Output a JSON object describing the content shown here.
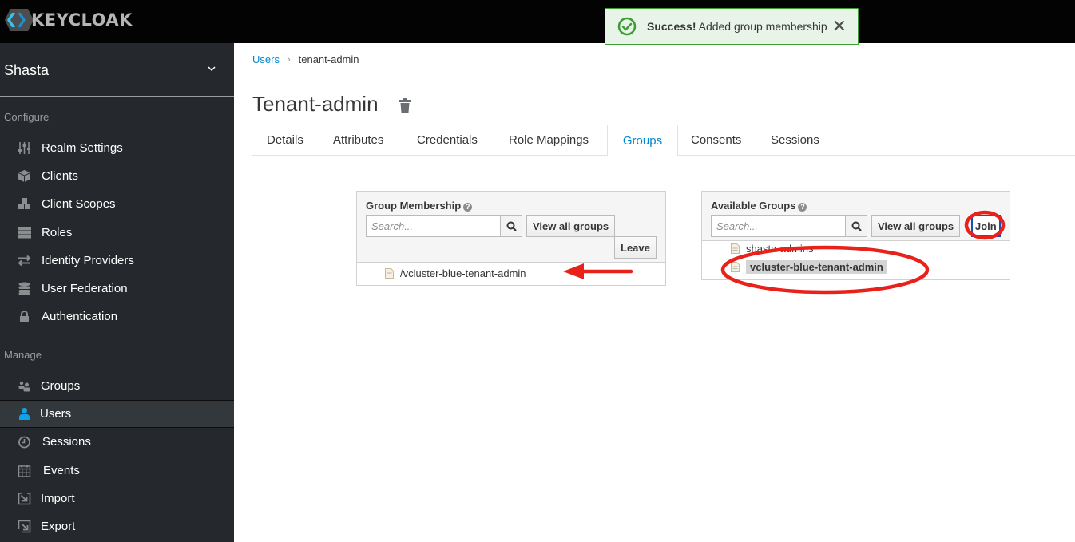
{
  "app": {
    "brand": "KEYCLOAK"
  },
  "toast": {
    "type": "success",
    "title": "Success!",
    "message": "Added group membership",
    "close_icon": "close-icon"
  },
  "sidebar": {
    "realm": "Shasta",
    "sections": [
      {
        "label": "Configure",
        "items": [
          {
            "label": "Realm Settings",
            "icon": "sliders-icon"
          },
          {
            "label": "Clients",
            "icon": "cube-icon"
          },
          {
            "label": "Client Scopes",
            "icon": "cubes-icon"
          },
          {
            "label": "Roles",
            "icon": "list-icon"
          },
          {
            "label": "Identity Providers",
            "icon": "exchange-icon"
          },
          {
            "label": "User Federation",
            "icon": "database-icon"
          },
          {
            "label": "Authentication",
            "icon": "lock-icon"
          }
        ]
      },
      {
        "label": "Manage",
        "items": [
          {
            "label": "Groups",
            "icon": "users-icon"
          },
          {
            "label": "Users",
            "icon": "user-icon",
            "active": true
          },
          {
            "label": "Sessions",
            "icon": "clock-icon"
          },
          {
            "label": "Events",
            "icon": "calendar-icon"
          },
          {
            "label": "Import",
            "icon": "import-icon"
          },
          {
            "label": "Export",
            "icon": "export-icon"
          }
        ]
      }
    ]
  },
  "breadcrumb": {
    "parent": "Users",
    "current": "tenant-admin"
  },
  "page": {
    "title": "Tenant-admin"
  },
  "tabs": [
    {
      "label": "Details"
    },
    {
      "label": "Attributes"
    },
    {
      "label": "Credentials"
    },
    {
      "label": "Role Mappings"
    },
    {
      "label": "Groups",
      "active": true
    },
    {
      "label": "Consents"
    },
    {
      "label": "Sessions"
    }
  ],
  "group_membership": {
    "title": "Group Membership",
    "search_placeholder": "Search...",
    "search_value": "",
    "view_all_label": "View all groups",
    "leave_label": "Leave",
    "items": [
      "/vcluster-blue-tenant-admin"
    ]
  },
  "available_groups": {
    "title": "Available Groups",
    "search_placeholder": "Search...",
    "search_value": "",
    "view_all_label": "View all groups",
    "join_label": "Join",
    "items": [
      {
        "label": "shasta-admins",
        "selected": false
      },
      {
        "label": "vcluster-blue-tenant-admin",
        "selected": true
      }
    ]
  },
  "annotations": {
    "color": "#e8211b"
  }
}
